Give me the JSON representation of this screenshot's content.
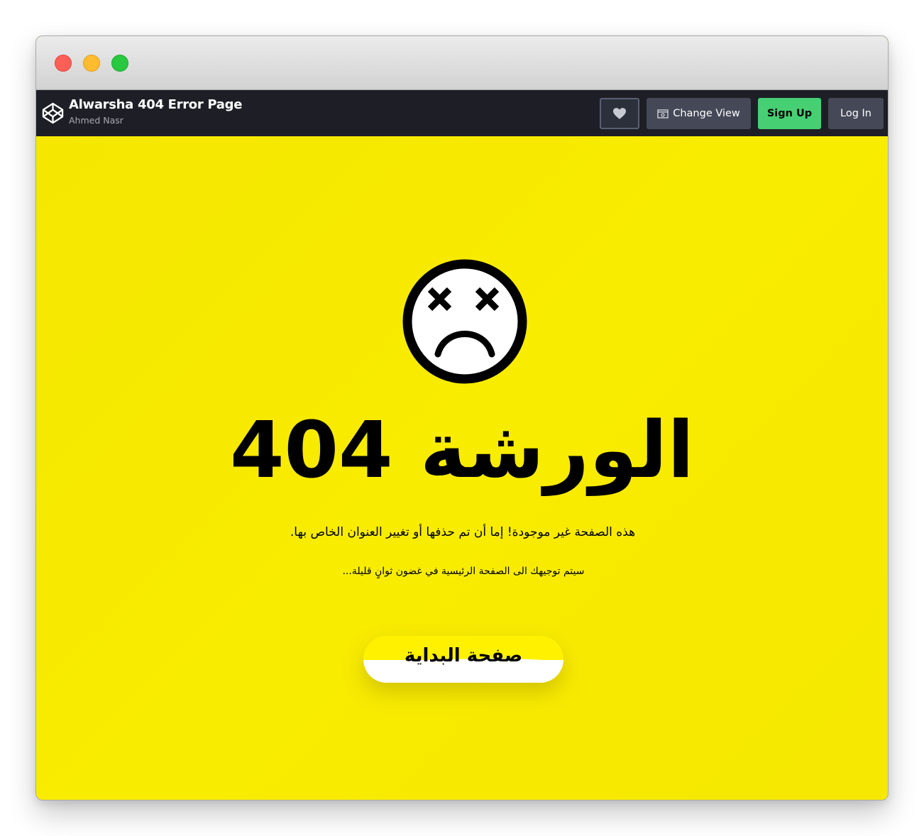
{
  "window": {
    "controls": [
      "close",
      "minimize",
      "maximize"
    ]
  },
  "navbar": {
    "logo_icon": "codepen-logo-icon",
    "pen_title": "Alwarsha 404 Error Page",
    "author": "Ahmed Nasr",
    "heart_icon": "heart-icon",
    "change_view_icon": "layout-view-icon",
    "change_view_label": "Change View",
    "signup_label": "Sign Up",
    "login_label": "Log In"
  },
  "page": {
    "icon": "dizzy-sad-face-icon",
    "headline": "الورشة 404",
    "message": "هذه الصفحة غير موجودة! إما أن تم حذفها أو تغيير العنوان الخاص بها.",
    "redirect_note": "سيتم توجيهك الى الصفحة الرئيسية في غضون ثوانٍ قليلة...",
    "home_button_label": "صفحة البداية"
  },
  "colors": {
    "background": "#f7e900",
    "navbar": "#1e1f26",
    "signup": "#47cf73",
    "nav_button": "#444857",
    "text": "#000000"
  }
}
